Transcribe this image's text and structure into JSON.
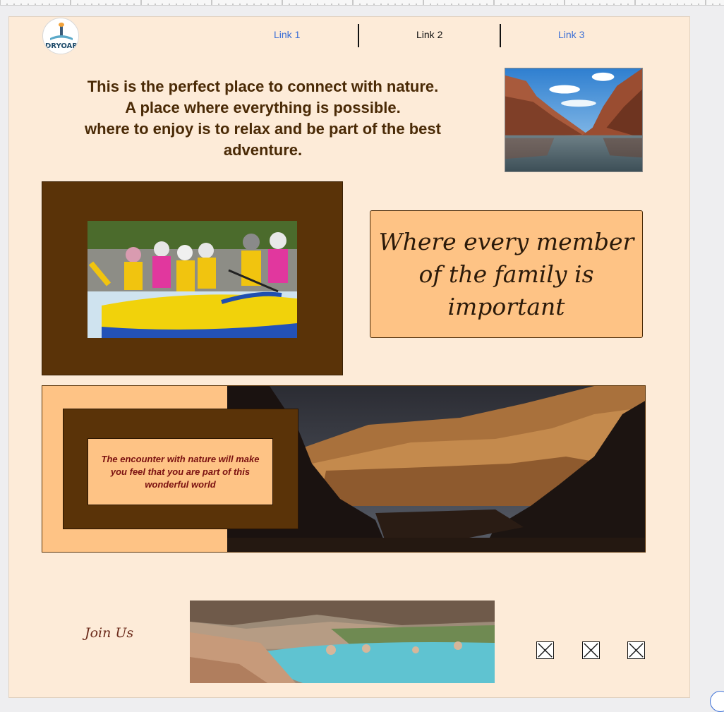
{
  "logo": {
    "text": "DRYOAR"
  },
  "nav": {
    "links": [
      {
        "label": "Link 1",
        "color": "#3b6fd6"
      },
      {
        "label": "Link 2",
        "color": "#111111"
      },
      {
        "label": "Link 3",
        "color": "#3b6fd6"
      }
    ]
  },
  "hero": {
    "lines": [
      "This is the perfect place to connect with nature.",
      "A place where everything is possible.",
      "where to enjoy is to relax and be part of the best adventure."
    ]
  },
  "family": {
    "text": "Where every member of the family is important"
  },
  "encounter": {
    "text": "The encounter with nature will make you feel that you are part of this wonderful world"
  },
  "footer": {
    "join_label": "Join Us",
    "social_icons": [
      "broken-image-icon",
      "broken-image-icon",
      "broken-image-icon"
    ]
  },
  "colors": {
    "canvas_bg": "#fdebd8",
    "brown": "#5a3308",
    "peach": "#fec385",
    "hero_text": "#4a2a06",
    "quote_text": "#7a1010"
  }
}
